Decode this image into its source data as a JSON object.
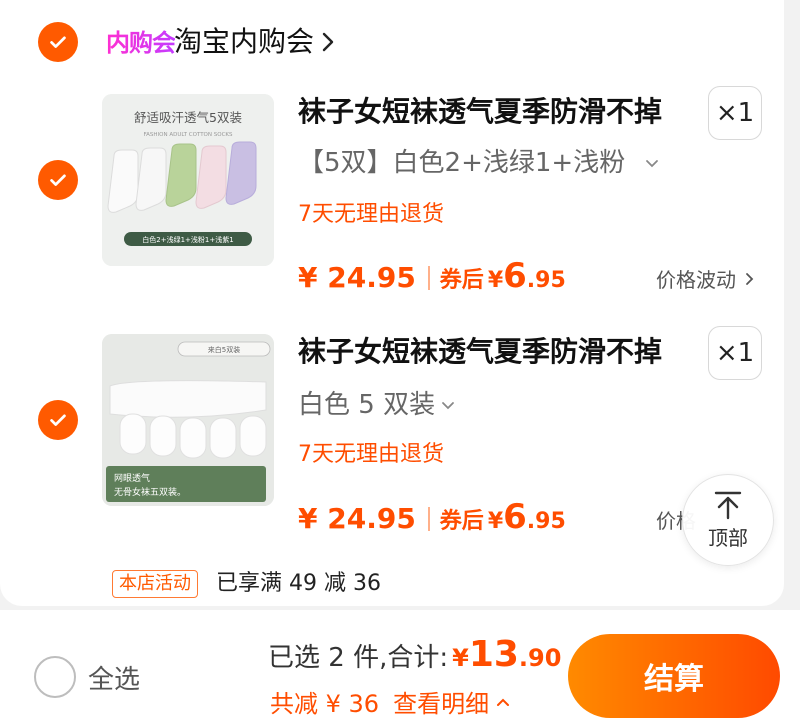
{
  "shop": {
    "logo_text": "内购会",
    "name": "淘宝内购会"
  },
  "items": [
    {
      "image_title": "舒适吸汗透气5双装",
      "image_subtitle": "FASHION ADULT COTTON SOCKS",
      "image_caption": "白色2+浅绿1+浅粉1+浅紫1",
      "title": "袜子女短袜透气夏季防滑不掉",
      "quantity": "×1",
      "sku": "【5双】白色2+浅绿1+浅粉",
      "return_policy": "7天无理由退货",
      "price": "¥ 24.95",
      "coupon_label": "券后",
      "coupon_yen": "¥",
      "coupon_price_int": "6",
      "coupon_price_dec": ".95",
      "price_note": "价格波动",
      "checked": true
    },
    {
      "image_tag": "来白5双装",
      "image_caption_line1": "网眼透气",
      "image_caption_line2": "无骨女袜五双装。",
      "title": "袜子女短袜透气夏季防滑不掉",
      "quantity": "×1",
      "sku": "白色 5 双装",
      "return_policy": "7天无理由退货",
      "price": "¥ 24.95",
      "coupon_label": "券后",
      "coupon_yen": "¥",
      "coupon_price_int": "6",
      "coupon_price_dec": ".95",
      "price_note": "价格",
      "checked": true
    }
  ],
  "store_activity": {
    "tag": "本店活动",
    "text": "已享满 49 减 36"
  },
  "back_to_top": {
    "label": "顶部"
  },
  "footer": {
    "select_all": "全选",
    "selected_count": "已选 2 件,",
    "total_label": "合计:",
    "total_yen": "¥",
    "total_int": "13",
    "total_dec": ".90",
    "discount_text": "共减 ¥ 36",
    "detail_link": "查看明细",
    "checkout": "结算"
  },
  "colors": {
    "accent": "#ff5a00",
    "price": "#ff4d00",
    "logo": "#e535e0"
  }
}
